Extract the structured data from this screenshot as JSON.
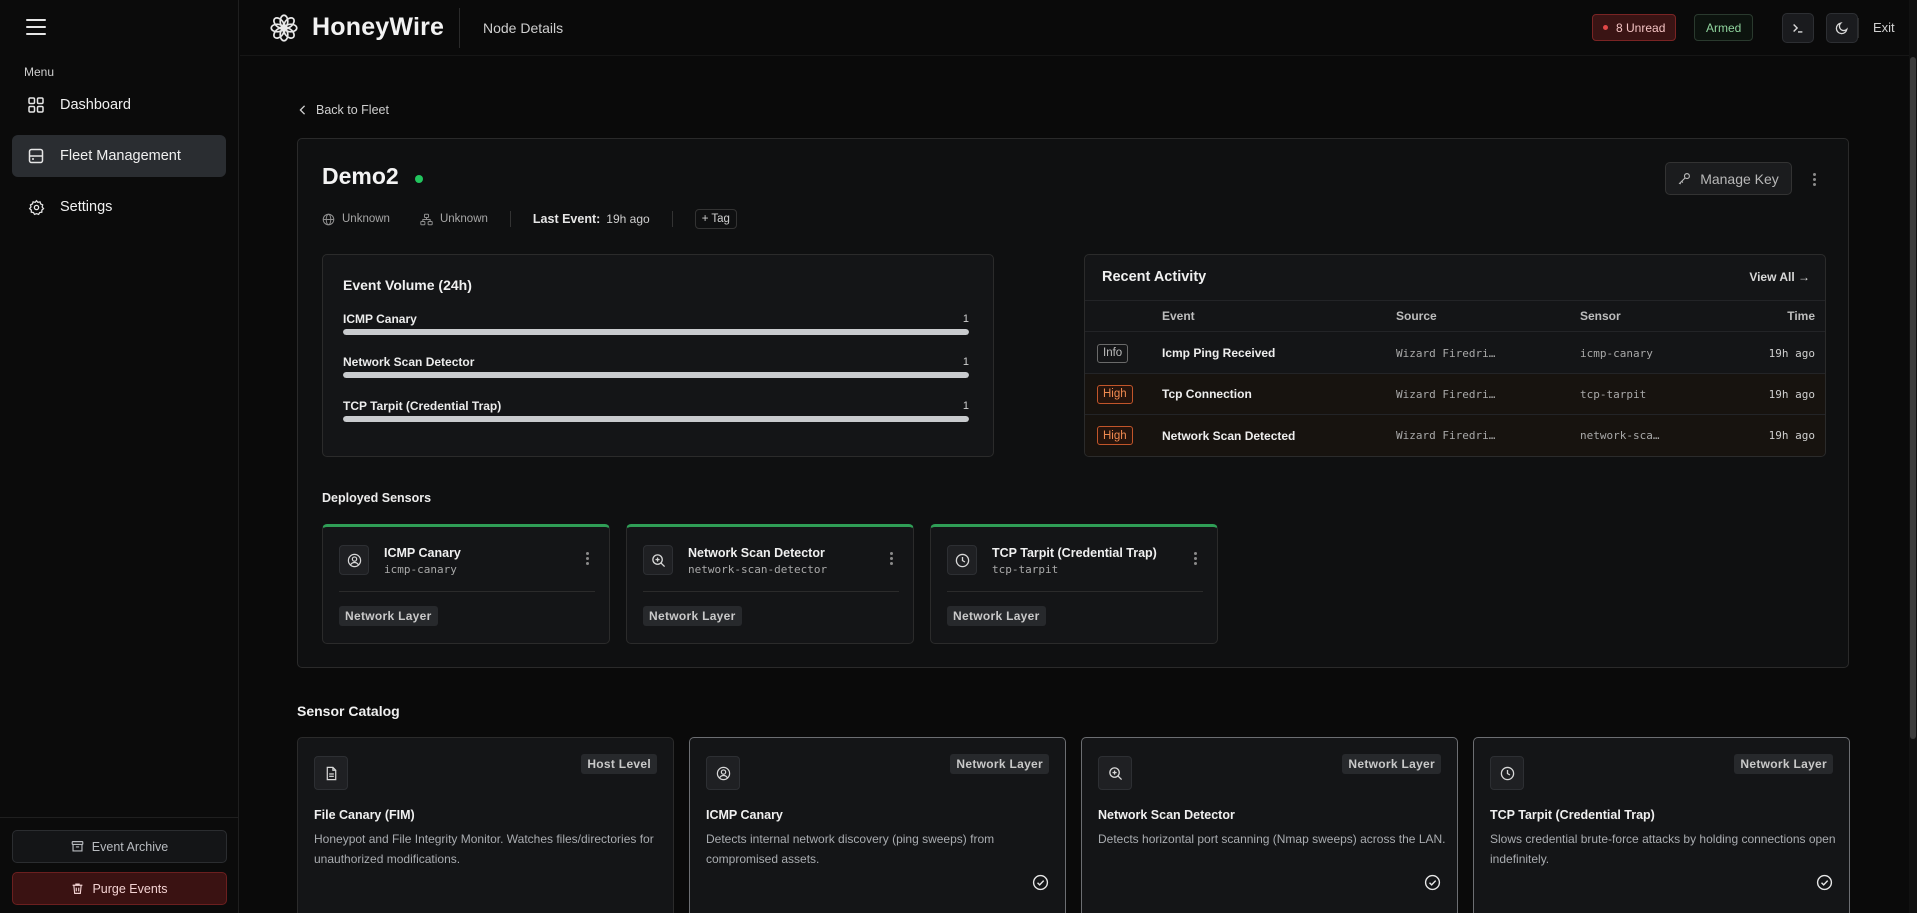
{
  "sidebar": {
    "menu_label": "Menu",
    "items": [
      {
        "label": "Dashboard",
        "icon": "grid-icon",
        "active": false
      },
      {
        "label": "Fleet Management",
        "icon": "server-icon",
        "active": true
      },
      {
        "label": "Settings",
        "icon": "gear-icon",
        "active": false
      }
    ],
    "archive_label": "Event Archive",
    "purge_label": "Purge Events"
  },
  "header": {
    "brand": "HoneyWire",
    "page": "Node Details",
    "unread_label": "8 Unread",
    "armed_label": "Armed",
    "exit_label": "Exit"
  },
  "back_label": "Back to Fleet",
  "node": {
    "name": "Demo2",
    "status": "online",
    "os": "Unknown",
    "network": "Unknown",
    "last_event_label": "Last Event:",
    "last_event_value": "19h ago",
    "tag_label": "+ Tag",
    "manage_key_label": "Manage Key"
  },
  "event_volume": {
    "title": "Event Volume (24h)",
    "rows": [
      {
        "name": "ICMP Canary",
        "count": "1",
        "fraction": 1.0
      },
      {
        "name": "Network Scan Detector",
        "count": "1",
        "fraction": 1.0
      },
      {
        "name": "TCP Tarpit (Credential Trap)",
        "count": "1",
        "fraction": 1.0
      }
    ]
  },
  "recent_activity": {
    "title": "Recent Activity",
    "view_all": "View All →",
    "columns": [
      "Event",
      "Source",
      "Sensor",
      "Time"
    ],
    "rows": [
      {
        "severity": "Info",
        "event": "Icmp Ping Received",
        "source": "Wizard Firedri…",
        "sensor": "icmp-canary",
        "time": "19h ago"
      },
      {
        "severity": "High",
        "event": "Tcp Connection",
        "source": "Wizard Firedri…",
        "sensor": "tcp-tarpit",
        "time": "19h ago"
      },
      {
        "severity": "High",
        "event": "Network Scan Detected",
        "source": "Wizard Firedri…",
        "sensor": "network-sca…",
        "time": "19h ago"
      }
    ]
  },
  "deployed": {
    "title": "Deployed Sensors",
    "sensors": [
      {
        "name": "ICMP Canary",
        "id": "icmp-canary",
        "layer": "Network Layer",
        "icon": "user-circle-icon"
      },
      {
        "name": "Network Scan Detector",
        "id": "network-scan-detector",
        "layer": "Network Layer",
        "icon": "zoom-icon"
      },
      {
        "name": "TCP Tarpit (Credential Trap)",
        "id": "tcp-tarpit",
        "layer": "Network Layer",
        "icon": "clock-icon"
      }
    ]
  },
  "catalog": {
    "title": "Sensor Catalog",
    "items": [
      {
        "name": "File Canary (FIM)",
        "level": "Host Level",
        "desc": "Honeypot and File Integrity Monitor. Watches files/directories for unauthorized modifications.",
        "icon": "file-icon",
        "installed": false
      },
      {
        "name": "ICMP Canary",
        "level": "Network Layer",
        "desc": "Detects internal network discovery (ping sweeps) from compromised assets.",
        "icon": "user-circle-icon",
        "installed": true
      },
      {
        "name": "Network Scan Detector",
        "level": "Network Layer",
        "desc": "Detects horizontal port scanning (Nmap sweeps) across the LAN.",
        "icon": "zoom-icon",
        "installed": true
      },
      {
        "name": "TCP Tarpit (Credential Trap)",
        "level": "Network Layer",
        "desc": "Slows credential brute-force attacks by holding connections open indefinitely.",
        "icon": "clock-icon",
        "installed": true
      }
    ]
  }
}
